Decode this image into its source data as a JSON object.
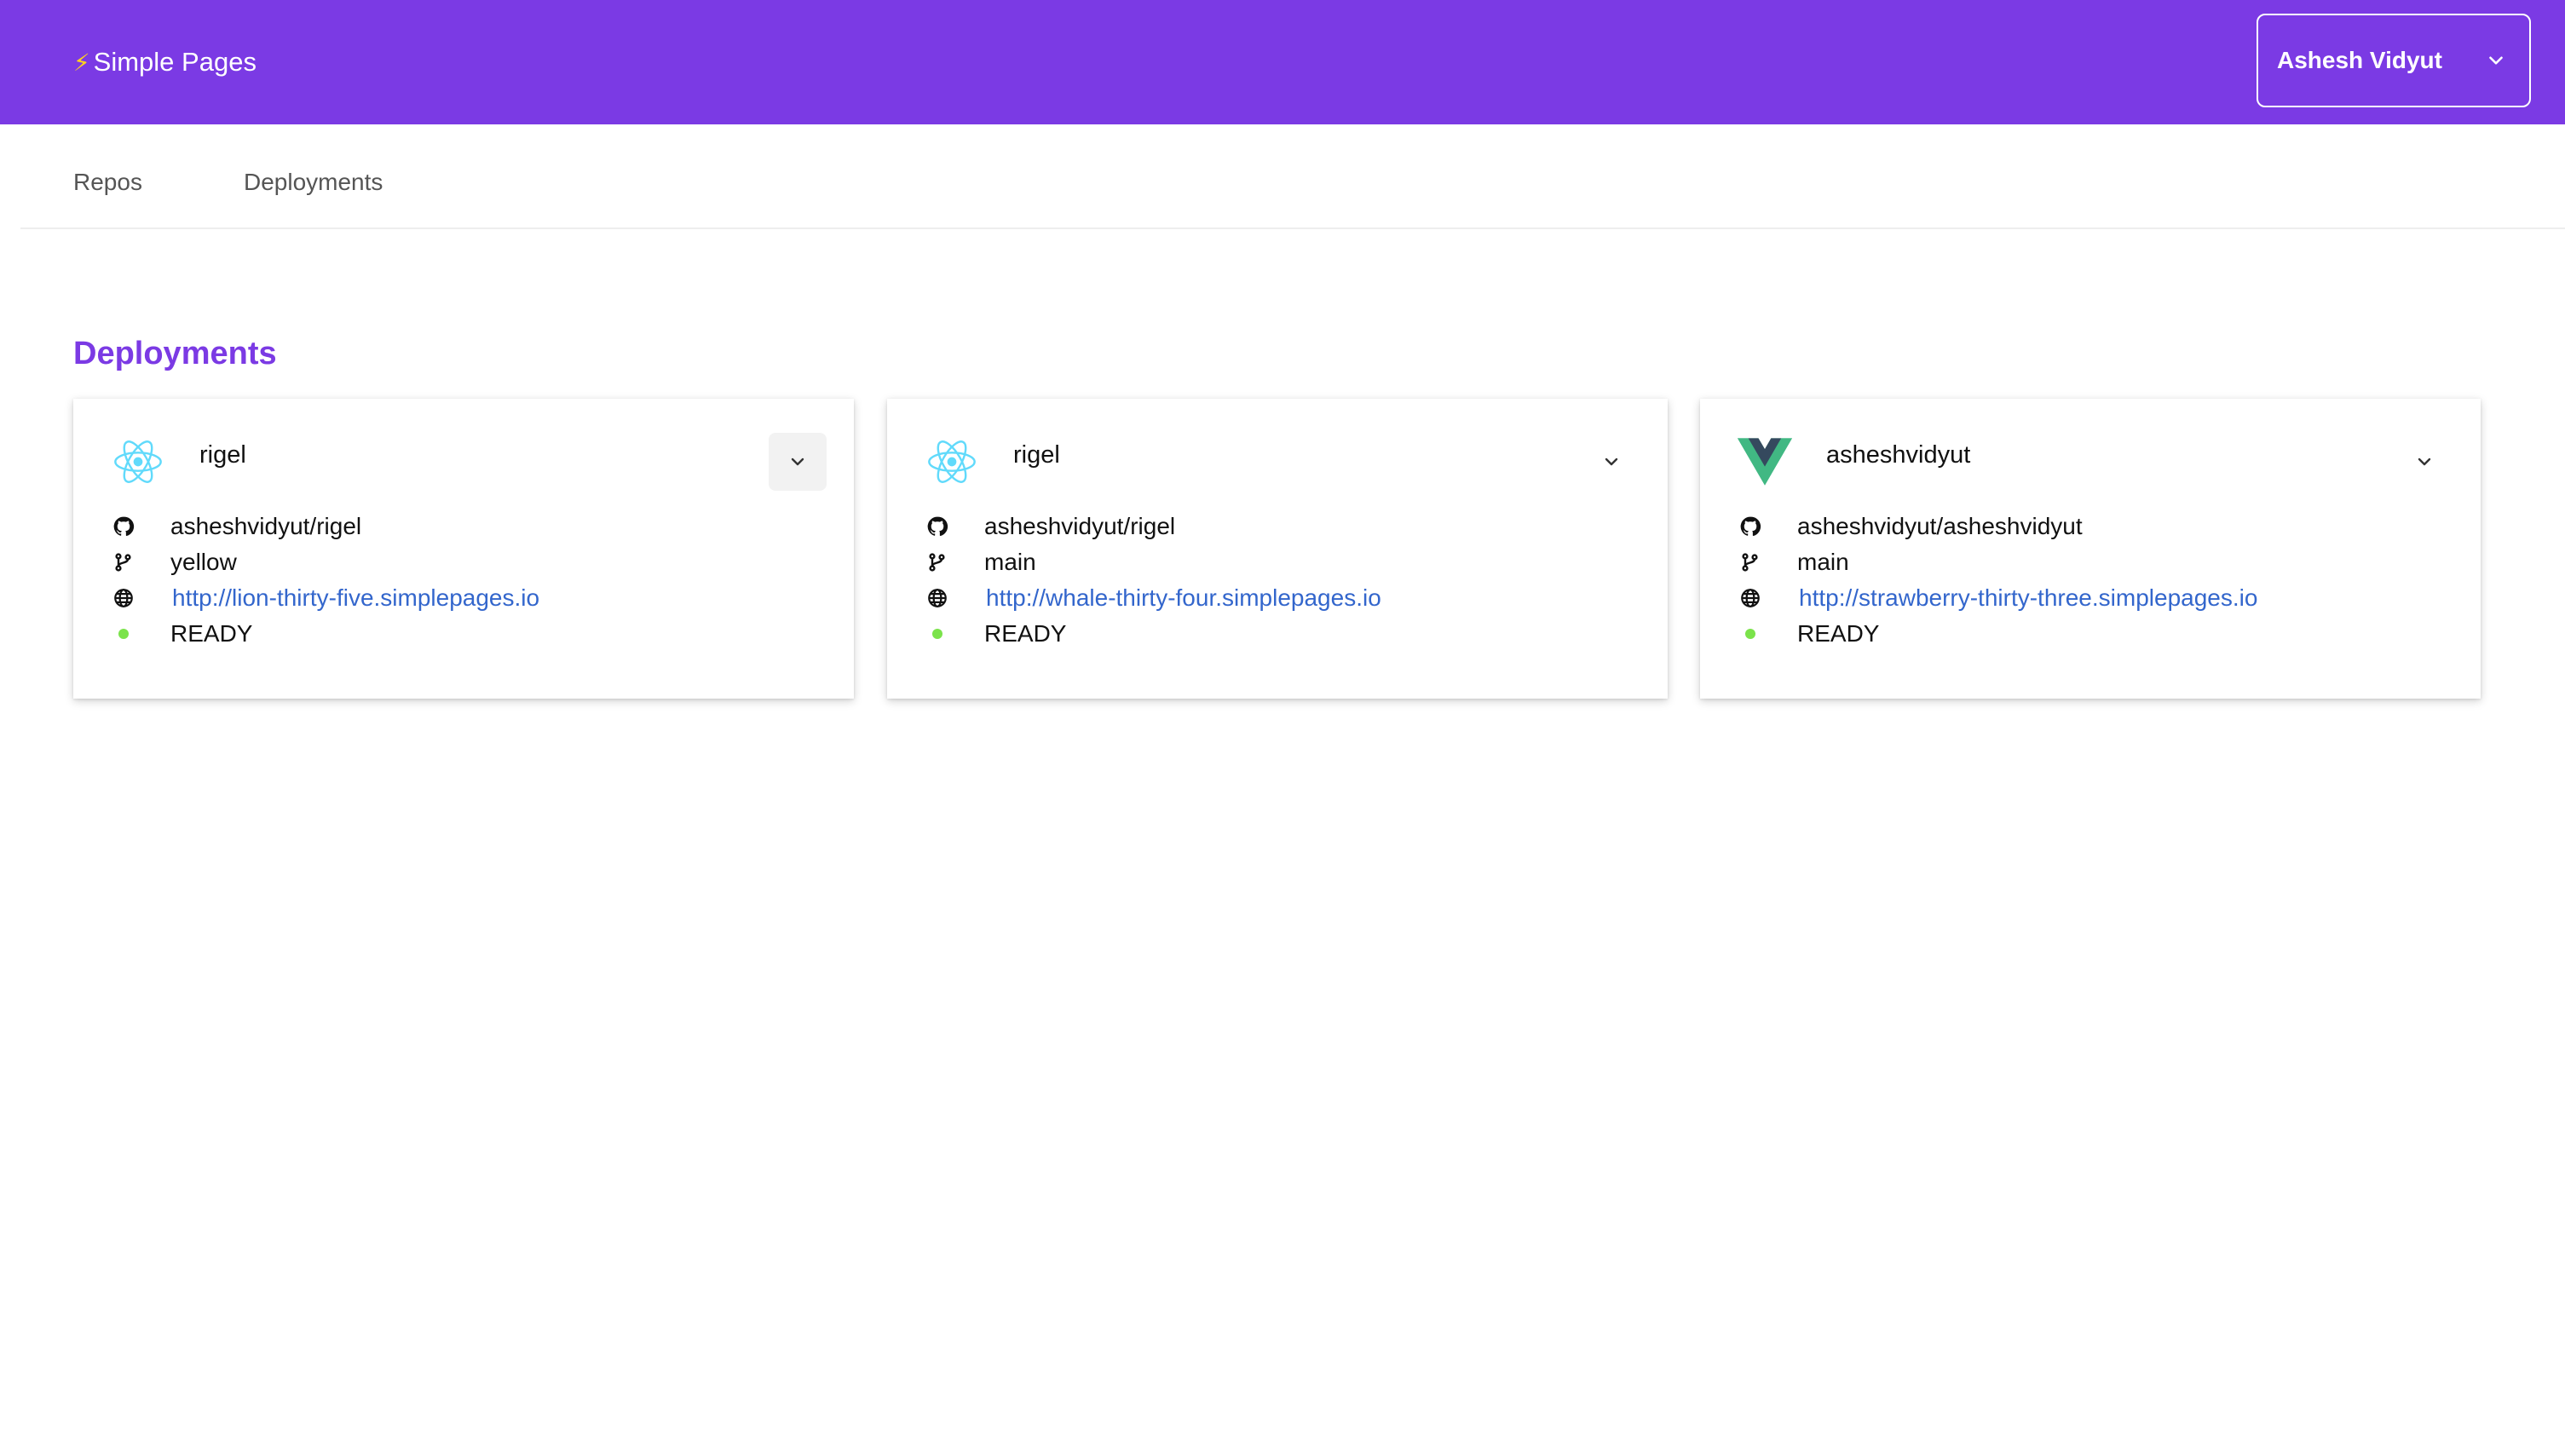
{
  "app": {
    "title": "Simple Pages",
    "accent": "#7b3ae4"
  },
  "user_menu": {
    "label": "Ashesh Vidyut"
  },
  "nav": {
    "tabs": [
      {
        "label": "Repos"
      },
      {
        "label": "Deployments"
      }
    ]
  },
  "main": {
    "title": "Deployments"
  },
  "deployments": [
    {
      "framework_icon": "react-icon",
      "name": "rigel",
      "repo": "asheshvidyut/rigel",
      "branch": "yellow",
      "url": "http://lion-thirty-five.simplepages.io",
      "status": "READY",
      "status_color": "#7be34b"
    },
    {
      "framework_icon": "react-icon",
      "name": "rigel",
      "repo": "asheshvidyut/rigel",
      "branch": "main",
      "url": "http://whale-thirty-four.simplepages.io",
      "status": "READY",
      "status_color": "#7be34b"
    },
    {
      "framework_icon": "vue-icon",
      "name": "asheshvidyut",
      "repo": "asheshvidyut/asheshvidyut",
      "branch": "main",
      "url": "http://strawberry-thirty-three.simplepages.io",
      "status": "READY",
      "status_color": "#7be34b"
    }
  ]
}
